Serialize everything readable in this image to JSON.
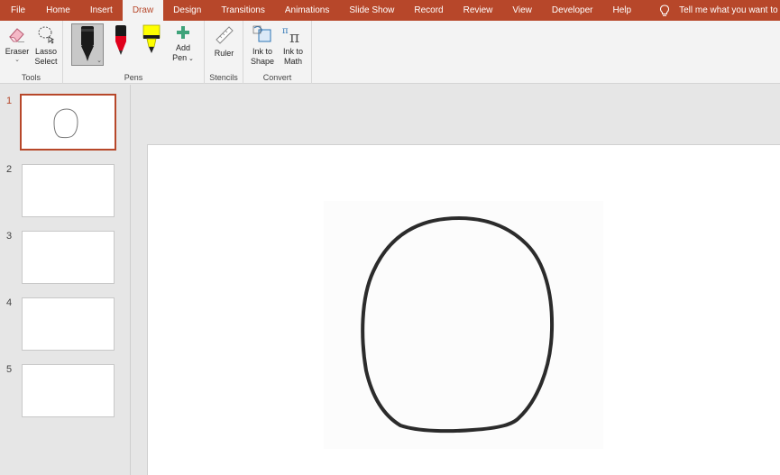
{
  "tabs": [
    "File",
    "Home",
    "Insert",
    "Draw",
    "Design",
    "Transitions",
    "Animations",
    "Slide Show",
    "Record",
    "Review",
    "View",
    "Developer",
    "Help"
  ],
  "active_tab": "Draw",
  "tell_me": "Tell me what you want to do",
  "ribbon": {
    "tools": {
      "label": "Tools",
      "eraser": "Eraser",
      "lasso_line1": "Lasso",
      "lasso_line2": "Select"
    },
    "pens": {
      "label": "Pens",
      "add_pen_line1": "Add",
      "add_pen_line2": "Pen"
    },
    "stencils": {
      "label": "Stencils",
      "ruler": "Ruler"
    },
    "convert": {
      "label": "Convert",
      "ink_shape_line1": "Ink to",
      "ink_shape_line2": "Shape",
      "ink_math_line1": "Ink to",
      "ink_math_line2": "Math"
    }
  },
  "colors": {
    "accent": "#b7472a",
    "pen_black": "#1a1a1a",
    "pen_red": "#e0001b",
    "highlighter": "#ffff00"
  },
  "slides": [
    "1",
    "2",
    "3",
    "4",
    "5"
  ],
  "selected_slide": "1"
}
